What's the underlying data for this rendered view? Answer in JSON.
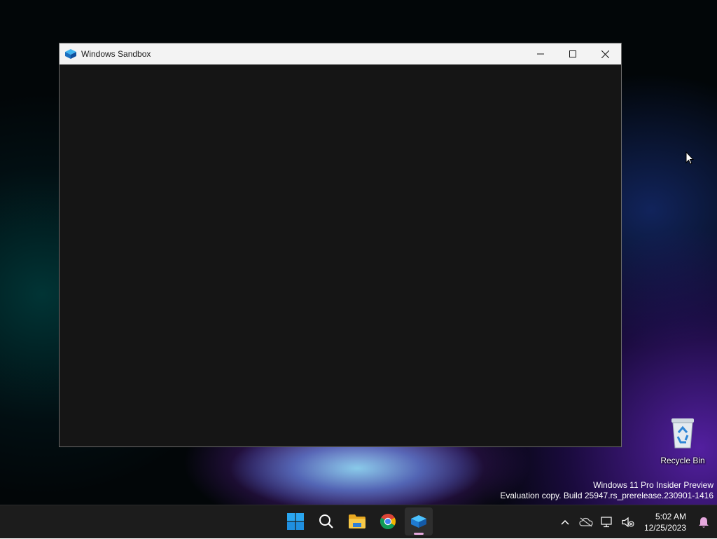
{
  "window": {
    "title": "Windows Sandbox",
    "minimize_label": "Minimize",
    "maximize_label": "Maximize",
    "close_label": "Close"
  },
  "desktop": {
    "recycle_bin_label": "Recycle Bin",
    "watermark_line1": "Windows 11 Pro Insider Preview",
    "watermark_line2": "Evaluation copy. Build 25947.rs_prerelease.230901-1416"
  },
  "taskbar": {
    "apps": [
      {
        "name": "start",
        "icon": "windows-logo-icon"
      },
      {
        "name": "search",
        "icon": "search-icon"
      },
      {
        "name": "file-explorer",
        "icon": "folder-icon"
      },
      {
        "name": "chrome",
        "icon": "chrome-icon"
      },
      {
        "name": "windows-sandbox",
        "icon": "sandbox-icon",
        "active": true
      }
    ],
    "tray": {
      "time": "5:02 AM",
      "date": "12/25/2023"
    }
  },
  "colors": {
    "taskbar_bg": "#1c1c1c",
    "titlebar_bg": "#f3f3f3",
    "window_client": "#151515",
    "active_indicator": "#e6a8de"
  }
}
